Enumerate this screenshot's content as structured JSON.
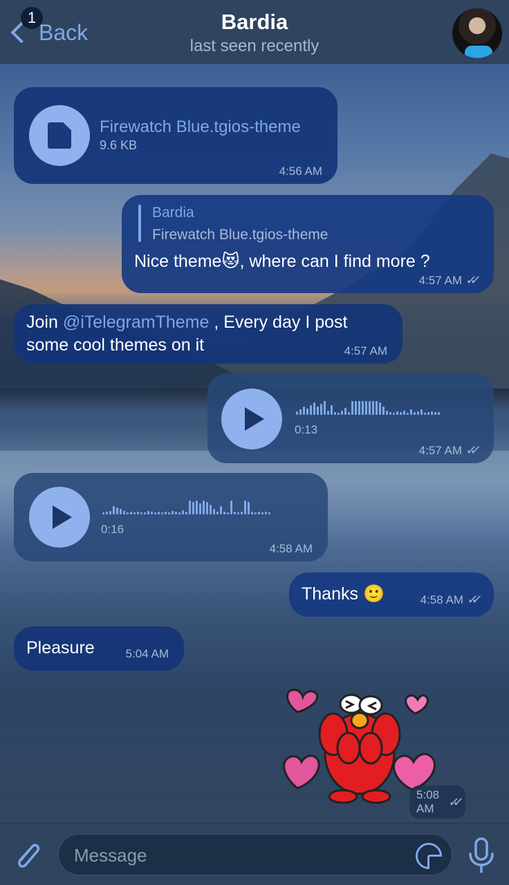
{
  "header": {
    "back_label": "Back",
    "unread_count": "1",
    "title": "Bardia",
    "subtitle": "last seen recently"
  },
  "messages": [
    {
      "type": "file",
      "direction": "incoming",
      "file_name": "Firewatch Blue.tgios-theme",
      "file_size": "9.6 KB",
      "time": "4:56 AM"
    },
    {
      "type": "text",
      "direction": "outgoing",
      "reply_author": "Bardia",
      "reply_text": "Firewatch Blue.tgios-theme",
      "text_before_emoji": "Nice theme",
      "emoji": "😻",
      "text_after_emoji": ", where can I find more ?",
      "time": "4:57 AM",
      "read": true
    },
    {
      "type": "text",
      "direction": "incoming",
      "text_prefix": "Join ",
      "mention": "@iTelegramTheme",
      "text_line1_suffix": " , Every day I post",
      "text_line2": "some cool themes on it",
      "time": "4:57 AM"
    },
    {
      "type": "voice",
      "direction": "outgoing",
      "duration": "0:13",
      "time": "4:57 AM",
      "read": true
    },
    {
      "type": "voice",
      "direction": "incoming",
      "duration": "0:16",
      "time": "4:58 AM"
    },
    {
      "type": "text",
      "direction": "outgoing",
      "text": "Thanks",
      "emoji": "🙂",
      "time": "4:58 AM",
      "read": true
    },
    {
      "type": "text",
      "direction": "incoming",
      "text": "Pleasure",
      "time": "5:04 AM"
    },
    {
      "type": "sticker",
      "direction": "outgoing",
      "time": "5:08 AM",
      "read": true
    }
  ],
  "input": {
    "placeholder": "Message"
  },
  "colors": {
    "accent": "#7fa8e8",
    "header_bg": "#30435f",
    "bubble_bg": "#163a82",
    "time_text": "#a8bbd8"
  },
  "icons": {
    "attach": "paperclip-icon",
    "sticker": "sticker-icon",
    "mic": "microphone-icon",
    "file": "document-icon",
    "play": "play-icon",
    "read": "double-check-icon",
    "back": "chevron-left-icon"
  }
}
